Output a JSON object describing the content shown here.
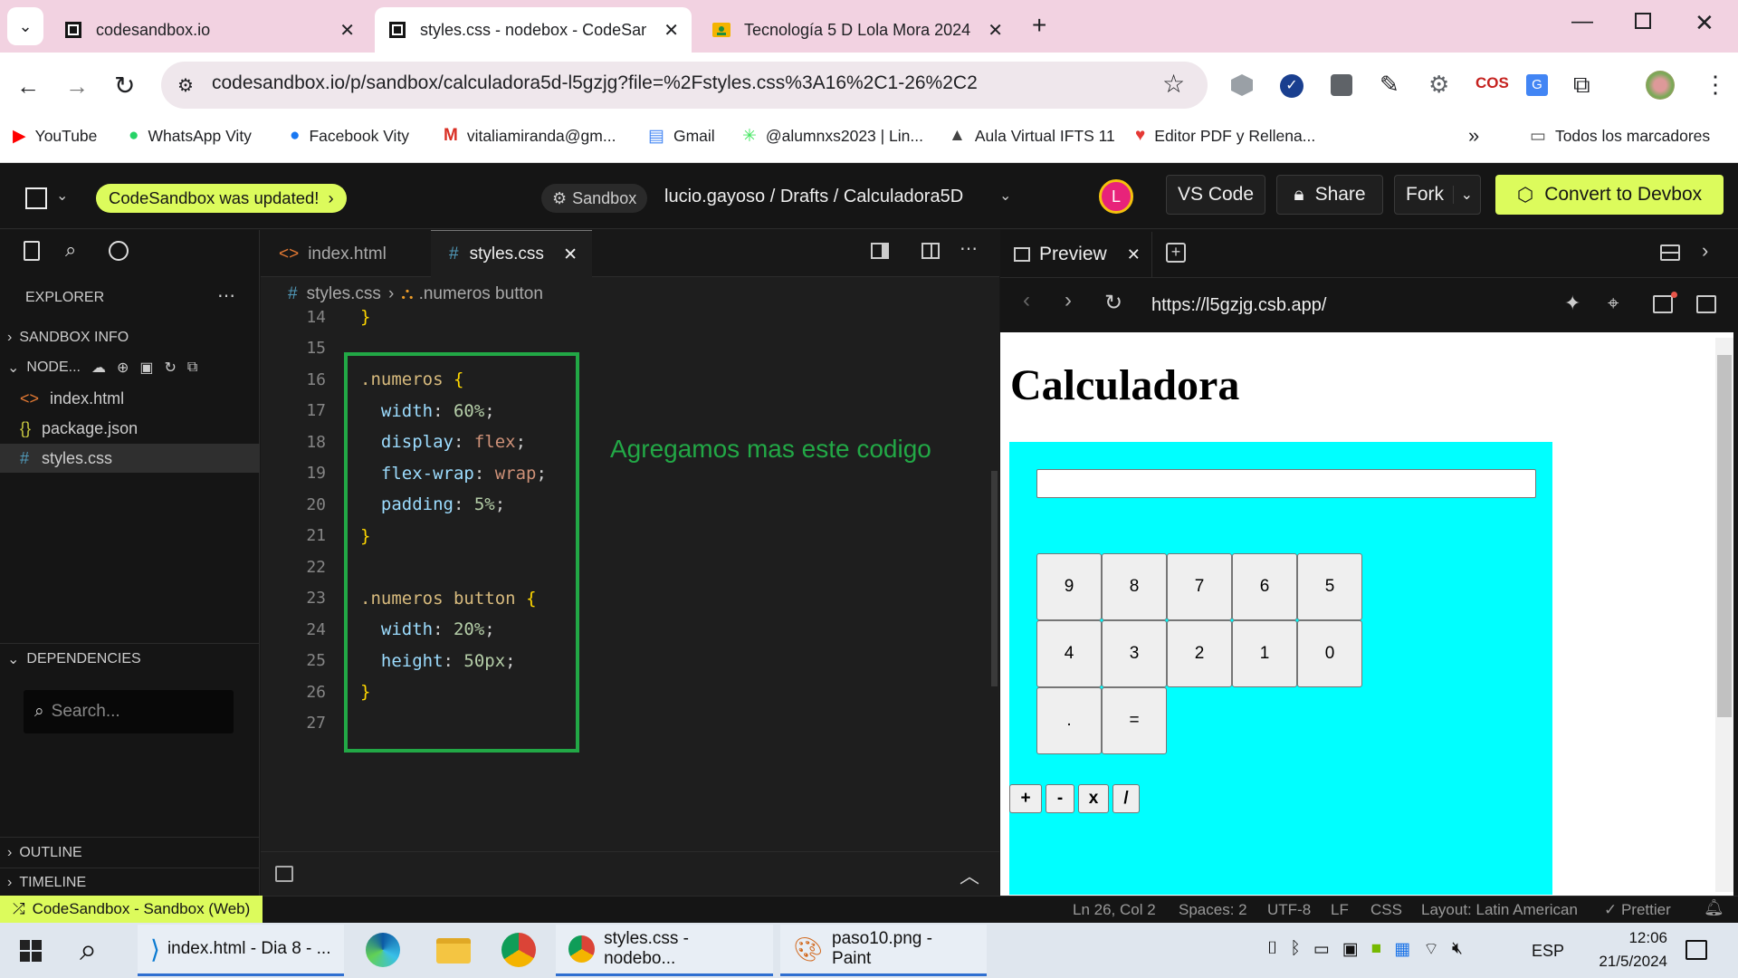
{
  "browser": {
    "tabs": [
      {
        "title": "codesandbox.io"
      },
      {
        "title": "styles.css - nodebox - CodeSan"
      },
      {
        "title": "Tecnología 5 D Lola Mora 2024"
      }
    ],
    "url": "codesandbox.io/p/sandbox/calculadora5d-l5gzjg?file=%2Fstyles.css%3A16%2C1-26%2C2",
    "bookmarks": [
      "YouTube",
      "WhatsApp Vity",
      "Facebook Vity",
      "vitaliamiranda@gm...",
      "Gmail",
      "@alumnxs2023 | Lin...",
      "Aula Virtual IFTS 11",
      "Editor PDF y Rellena..."
    ],
    "all_bookmarks": "Todos los marcadores"
  },
  "csb": {
    "update_badge": "CodeSandbox was updated!",
    "sandbox_chip": "Sandbox",
    "path": "lucio.gayoso / Drafts / Calculadora5D",
    "avatar_letter": "L",
    "vscode_label": "VS Code",
    "share_label": "Share",
    "fork_label": "Fork",
    "devbox_label": "Convert to Devbox"
  },
  "sidebar": {
    "explorer": "EXPLORER",
    "sandbox_info": "SANDBOX INFO",
    "node_section": "NODE...",
    "files": [
      "index.html",
      "package.json",
      "styles.css"
    ],
    "dependencies": "DEPENDENCIES",
    "search_placeholder": "Search...",
    "outline": "OUTLINE",
    "timeline": "TIMELINE"
  },
  "editor": {
    "tabs": [
      "index.html",
      "styles.css"
    ],
    "breadcrumb_file": "styles.css",
    "breadcrumb_symbol": ".numeros button",
    "annotation": "Agregamos mas este codigo",
    "lines": [
      {
        "n": "14",
        "tokens": [
          {
            "t": "}",
            "c": "brc"
          }
        ]
      },
      {
        "n": "15",
        "tokens": []
      },
      {
        "n": "16",
        "tokens": [
          {
            "t": ".numeros",
            "c": "sel"
          },
          {
            "t": " ",
            "c": "pun"
          },
          {
            "t": "{",
            "c": "brc"
          }
        ]
      },
      {
        "n": "17",
        "tokens": [
          {
            "t": "  width",
            "c": "prop"
          },
          {
            "t": ": ",
            "c": "pun"
          },
          {
            "t": "60%",
            "c": "num"
          },
          {
            "t": ";",
            "c": "pun"
          }
        ]
      },
      {
        "n": "18",
        "tokens": [
          {
            "t": "  display",
            "c": "prop"
          },
          {
            "t": ": ",
            "c": "pun"
          },
          {
            "t": "flex",
            "c": "val"
          },
          {
            "t": ";",
            "c": "pun"
          }
        ]
      },
      {
        "n": "19",
        "tokens": [
          {
            "t": "  flex-wrap",
            "c": "prop"
          },
          {
            "t": ": ",
            "c": "pun"
          },
          {
            "t": "wrap",
            "c": "val"
          },
          {
            "t": ";",
            "c": "pun"
          }
        ]
      },
      {
        "n": "20",
        "tokens": [
          {
            "t": "  padding",
            "c": "prop"
          },
          {
            "t": ": ",
            "c": "pun"
          },
          {
            "t": "5%",
            "c": "num"
          },
          {
            "t": ";",
            "c": "pun"
          }
        ]
      },
      {
        "n": "21",
        "tokens": [
          {
            "t": "}",
            "c": "brc"
          }
        ]
      },
      {
        "n": "22",
        "tokens": []
      },
      {
        "n": "23",
        "tokens": [
          {
            "t": ".numeros",
            "c": "sel"
          },
          {
            "t": " ",
            "c": "pun"
          },
          {
            "t": "button",
            "c": "sel"
          },
          {
            "t": " ",
            "c": "pun"
          },
          {
            "t": "{",
            "c": "brc"
          }
        ]
      },
      {
        "n": "24",
        "tokens": [
          {
            "t": "  width",
            "c": "prop"
          },
          {
            "t": ": ",
            "c": "pun"
          },
          {
            "t": "20%",
            "c": "num"
          },
          {
            "t": ";",
            "c": "pun"
          }
        ]
      },
      {
        "n": "25",
        "tokens": [
          {
            "t": "  height",
            "c": "prop"
          },
          {
            "t": ": ",
            "c": "pun"
          },
          {
            "t": "50px",
            "c": "num"
          },
          {
            "t": ";",
            "c": "pun"
          }
        ]
      },
      {
        "n": "26",
        "tokens": [
          {
            "t": "}",
            "c": "brc"
          }
        ]
      },
      {
        "n": "27",
        "tokens": []
      }
    ]
  },
  "preview": {
    "tab_label": "Preview",
    "url": "https://l5gzjg.csb.app/",
    "heading": "Calculadora",
    "digits": [
      "9",
      "8",
      "7",
      "6",
      "5",
      "4",
      "3",
      "2",
      "1",
      "0",
      ".",
      "="
    ],
    "operators": [
      "+",
      "-",
      "x",
      "/"
    ]
  },
  "statusbar": {
    "remote": "CodeSandbox - Sandbox (Web)",
    "position": "Ln 26, Col 2",
    "spaces": "Spaces: 2",
    "encoding": "UTF-8",
    "eol": "LF",
    "language": "CSS",
    "layout": "Layout: Latin American",
    "prettier": "Prettier"
  },
  "taskbar": {
    "apps": [
      "index.html - Dia 8 - ...",
      "styles.css - nodebo...",
      "paso10.png - Paint"
    ],
    "lang": "ESP",
    "time": "12:06",
    "date": "21/5/2024"
  },
  "colors": {
    "accent_lime": "#dcfb5c",
    "annotation_green": "#22a846",
    "preview_cyan": "#00ffff",
    "avatar_pink": "#e8237a"
  }
}
